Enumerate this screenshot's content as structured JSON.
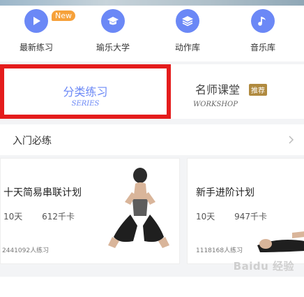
{
  "quick_nav": [
    {
      "label": "最新练习",
      "icon": "play-icon",
      "badge": "New"
    },
    {
      "label": "瑜乐大学",
      "icon": "graduation-cap-icon"
    },
    {
      "label": "动作库",
      "icon": "layers-icon"
    },
    {
      "label": "音乐库",
      "icon": "music-note-icon"
    }
  ],
  "tabs": [
    {
      "title": "分类练习",
      "subtitle": "SERIES",
      "active": true
    },
    {
      "title": "名师课堂",
      "subtitle": "WORKSHOP",
      "badge": "推荐"
    }
  ],
  "section": {
    "title": "入门必练"
  },
  "cards": [
    {
      "title": "十天简易串联计划",
      "days": "10天",
      "calories": "612千卡",
      "practitioners": "2441092人练习"
    },
    {
      "title": "新手进阶计划",
      "days": "10天",
      "calories": "947千卡",
      "practitioners": "1118168人练习"
    }
  ],
  "watermark": "Baidu 经验",
  "colors": {
    "accent": "#6b88f6",
    "badge_new": "#f6a13a",
    "badge_recommend": "#b08a3f",
    "highlight_box": "#e41c1c"
  }
}
